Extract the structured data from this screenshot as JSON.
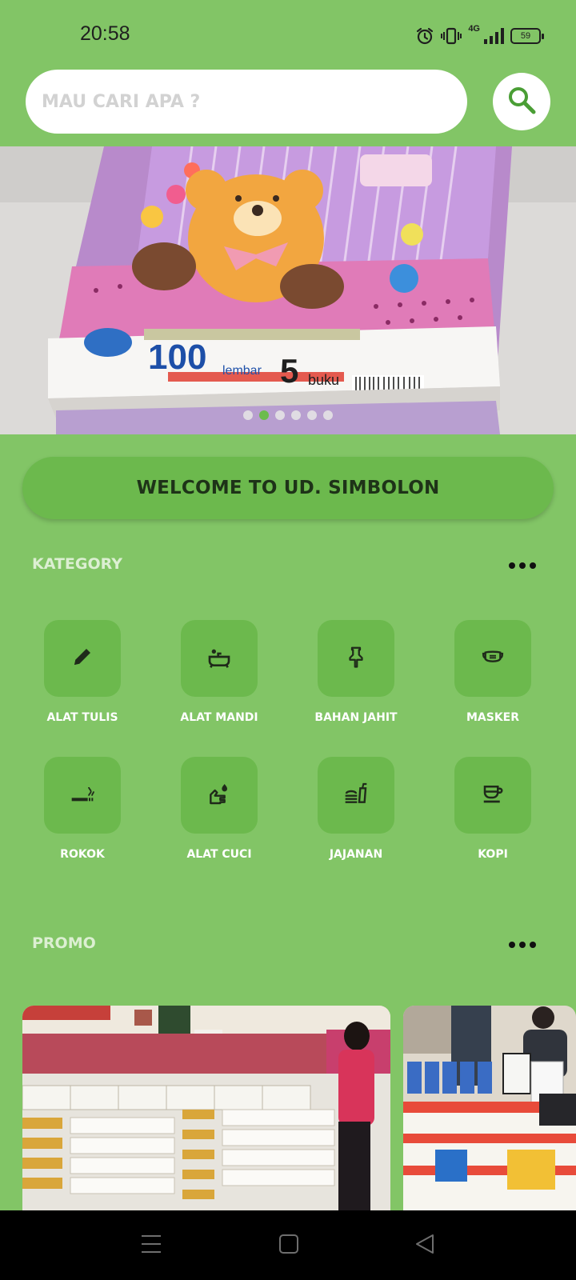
{
  "status_bar": {
    "time": "20:58",
    "network": "4G",
    "battery": "59"
  },
  "search": {
    "placeholder": "MAU CARI APA ?"
  },
  "banner": {
    "slide_count": 6,
    "active_slide": 2
  },
  "welcome": {
    "label": "WELCOME TO UD. SIMBOLON"
  },
  "category": {
    "title": "KATEGORY",
    "items": [
      {
        "label": "ALAT TULIS",
        "icon": "pencil-icon"
      },
      {
        "label": "ALAT MANDI",
        "icon": "bathtub-icon"
      },
      {
        "label": "BAHAN JAHIT",
        "icon": "pin-icon"
      },
      {
        "label": "MASKER",
        "icon": "mask-icon"
      },
      {
        "label": "ROKOK",
        "icon": "smoking-icon"
      },
      {
        "label": "ALAT CUCI",
        "icon": "hand-wash-icon"
      },
      {
        "label": "JAJANAN",
        "icon": "fastfood-icon"
      },
      {
        "label": "KOPI",
        "icon": "coffee-icon"
      }
    ]
  },
  "promo": {
    "title": "PROMO"
  },
  "colors": {
    "background": "#82c566",
    "tile": "#6cb94d",
    "active_dot": "#6cbc4c"
  }
}
